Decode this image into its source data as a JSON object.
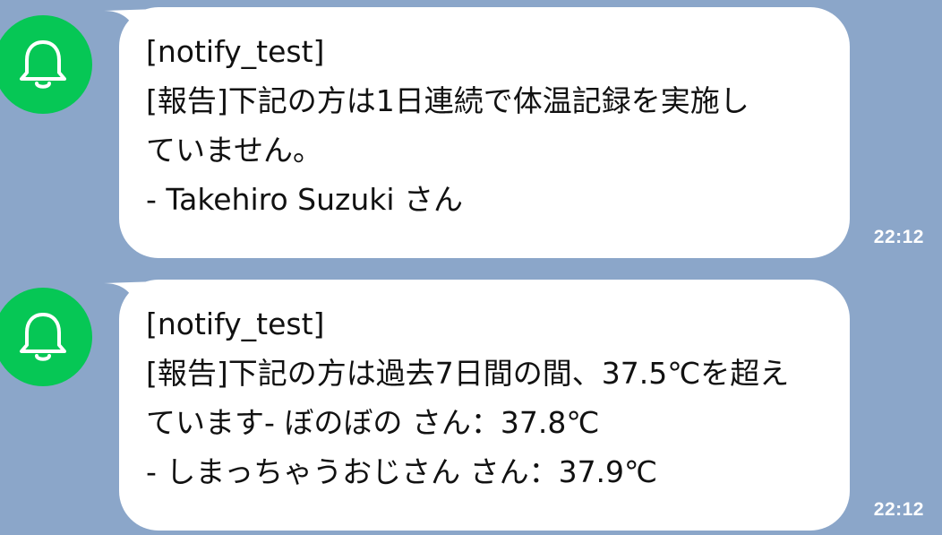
{
  "theme": {
    "background": "#8ba6c9",
    "bubble": "#ffffff",
    "avatar": "#06c755",
    "text": "#111111",
    "time_text": "#ffffff"
  },
  "messages": [
    {
      "avatar_icon": "bell-icon",
      "lines": [
        "[notify_test]",
        "[報告]下記の方は1日連続で体温記録を実施し",
        "ていません。",
        "- Takehiro Suzuki さん"
      ],
      "time": "22:12"
    },
    {
      "avatar_icon": "bell-icon",
      "lines": [
        "[notify_test]",
        "[報告]下記の方は過去7日間の間、37.5℃を超え",
        "ています- ぼのぼの さん：37.8℃",
        "- しまっちゃうおじさん さん：37.9℃"
      ],
      "time": "22:12"
    }
  ]
}
